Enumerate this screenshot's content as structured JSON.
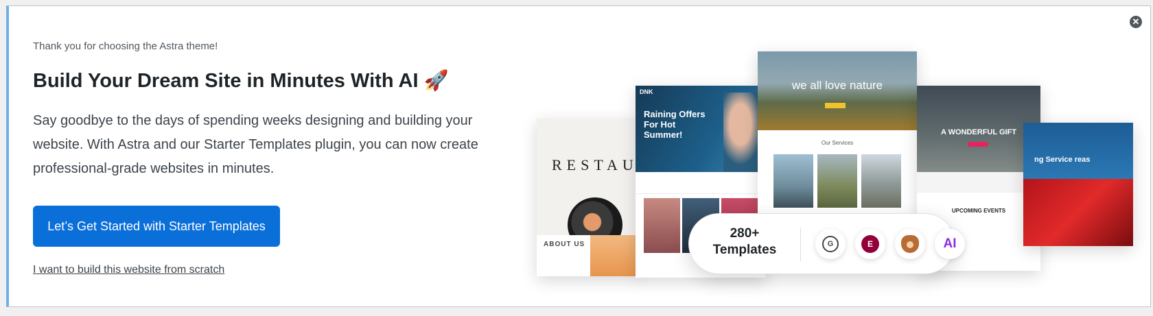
{
  "notice": {
    "subtitle": "Thank you for choosing the Astra theme!",
    "title": "Build Your Dream Site in Minutes With AI 🚀",
    "description": "Say goodbye to the days of spending weeks designing and building your website. With Astra and our Starter Templates plugin, you can now create professional-grade websites in minutes.",
    "cta_label": "Let’s Get Started with Starter Templates",
    "scratch_link": "I want to build this website from scratch",
    "close_glyph": "✕",
    "accent_color": "#72aee6",
    "button_color": "#0b6fd9"
  },
  "collage": {
    "card1": {
      "word": "RESTAUR",
      "about": "ABOUT US"
    },
    "card2": {
      "nav": "DNK",
      "headline": "Raining Offers For Hot Summer!"
    },
    "card3": {
      "headline": "we all love nature",
      "section": "Our Services"
    },
    "card4": {
      "headline": "A WONDERFUL GIFT",
      "section": "UPCOMING EVENTS"
    },
    "card5": {
      "headline": "ng Service reas"
    }
  },
  "badge": {
    "count": "280+",
    "label": "Templates",
    "icons": [
      "gutenberg-icon",
      "elementor-icon",
      "beaver-builder-icon",
      "ai-icon"
    ],
    "g_glyph": "G",
    "e_glyph": "E",
    "ai_text": "AI"
  }
}
